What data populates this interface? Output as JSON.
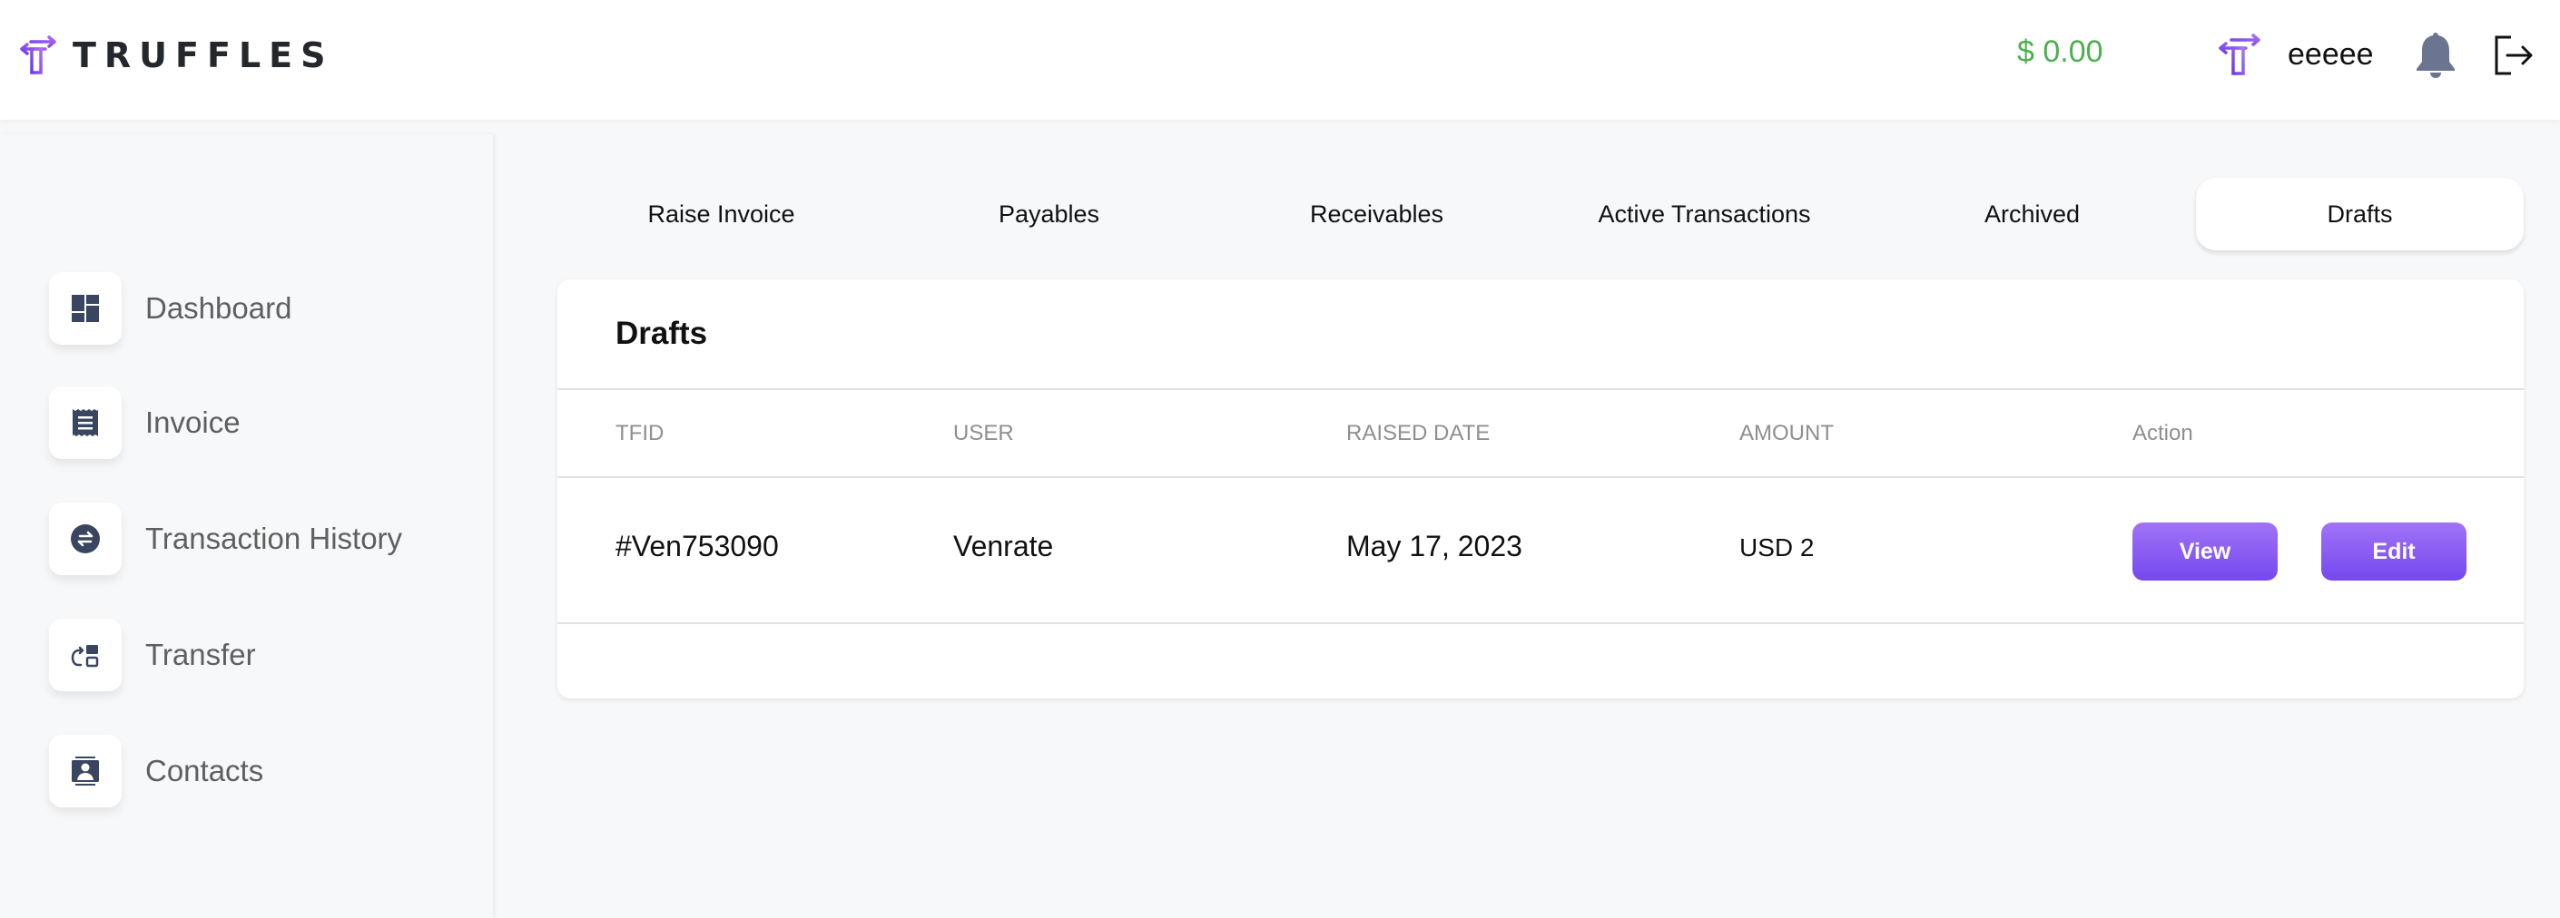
{
  "header": {
    "brand": "TRUFFLES",
    "balance": "$ 0.00",
    "username": "eeeee",
    "icons": {
      "logo": "truffles-logo-icon",
      "user": "truffles-user-icon",
      "notifications": "bell-icon",
      "logout": "logout-icon"
    },
    "colors": {
      "balance": "#4caf50",
      "brand_purple": "#7448ef"
    }
  },
  "sidebar": {
    "items": [
      {
        "label": "Dashboard",
        "icon": "dashboard-icon"
      },
      {
        "label": "Invoice",
        "icon": "receipt-icon"
      },
      {
        "label": "Transaction History",
        "icon": "swap-circle-icon"
      },
      {
        "label": "Transfer",
        "icon": "transfer-icon"
      },
      {
        "label": "Contacts",
        "icon": "contact-card-icon"
      }
    ]
  },
  "tabs": [
    {
      "label": "Raise Invoice",
      "active": false
    },
    {
      "label": "Payables",
      "active": false
    },
    {
      "label": "Receivables",
      "active": false
    },
    {
      "label": "Active Transactions",
      "active": false
    },
    {
      "label": "Archived",
      "active": false
    },
    {
      "label": "Drafts",
      "active": true
    }
  ],
  "drafts": {
    "title": "Drafts",
    "columns": [
      "TFID",
      "USER",
      "RAISED DATE",
      "AMOUNT",
      "Action"
    ],
    "rows": [
      {
        "tfid": "#Ven753090",
        "user": "Venrate",
        "raised_date": "May 17, 2023",
        "amount": "USD 2",
        "actions": {
          "view": "View",
          "edit": "Edit"
        }
      }
    ]
  }
}
